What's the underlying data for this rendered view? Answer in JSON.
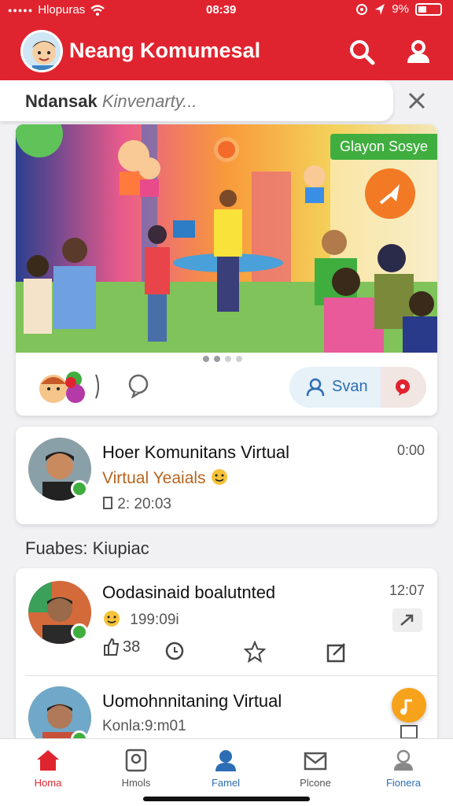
{
  "status_bar": {
    "carrier": "Hlopuras",
    "time": "08:39",
    "battery_text": "9%"
  },
  "header": {
    "title": "Neang Komumesal",
    "search_icon": "search-icon",
    "profile_icon": "user-icon"
  },
  "search": {
    "label_bold": "Ndansak",
    "label_hint": "Kinvenarty..."
  },
  "banner": {
    "badge": "Glayon Sosye",
    "join_label": "Svan"
  },
  "post1": {
    "title": "Hoer Komunitans Virtual",
    "subtitle": "Virtual Yeaials",
    "meta": "2: 20:03",
    "time": "0:00"
  },
  "section": {
    "label": "Fuabes: Kiupiac"
  },
  "post2": {
    "title": "Oodasinaid boalutnted",
    "meta": "199:09i",
    "time": "12:07",
    "likes": "38"
  },
  "post3": {
    "title": "Uomohnnitaning Virtual",
    "subtitle": "Konla:9:m01"
  },
  "bottom_nav": [
    {
      "label": "Homa",
      "color": "#e0242f"
    },
    {
      "label": "Hmols",
      "color": "#555555"
    },
    {
      "label": "Famel",
      "color": "#2d6db5"
    },
    {
      "label": "Plcone",
      "color": "#555555"
    },
    {
      "label": "Fionera",
      "color": "#2d6db5"
    }
  ],
  "colors": {
    "brand_red": "#e0242f",
    "accent_orange": "#f37a24",
    "online_green": "#3fae3f"
  }
}
